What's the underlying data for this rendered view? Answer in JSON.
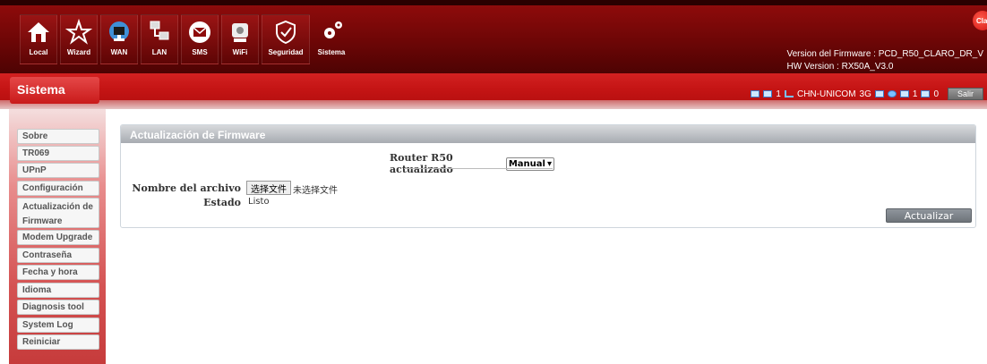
{
  "nav": {
    "items": [
      {
        "label": "Local",
        "icon": "home-icon"
      },
      {
        "label": "Wizard",
        "icon": "wizard-icon"
      },
      {
        "label": "WAN",
        "icon": "wan-icon"
      },
      {
        "label": "LAN",
        "icon": "lan-icon"
      },
      {
        "label": "SMS",
        "icon": "sms-icon"
      },
      {
        "label": "WiFi",
        "icon": "wifi-icon"
      },
      {
        "label": "Seguridad",
        "icon": "shield-icon"
      },
      {
        "label": "Sistema",
        "icon": "gear-icon"
      }
    ]
  },
  "header": {
    "brand": "Claro",
    "firmware_version": "Version del Firmware : PCD_R50_CLARO_DR_V",
    "hw_version": "HW Version : RX50A_V3.0"
  },
  "section": {
    "title": "Sistema"
  },
  "status": {
    "sim_count": "1",
    "operator": "CHN-UNICOM",
    "network": "3G",
    "lan_count": "1",
    "wlan_count": "0",
    "logout_label": "Salir"
  },
  "sidebar": {
    "items": [
      {
        "label": "Sobre"
      },
      {
        "label": "TR069"
      },
      {
        "label": "UPnP"
      },
      {
        "label": "Configuración"
      },
      {
        "label": "Actualización de Firmware"
      },
      {
        "label": "Modem Upgrade"
      },
      {
        "label": "Contraseña"
      },
      {
        "label": "Fecha y hora"
      },
      {
        "label": "Idioma"
      },
      {
        "label": "Diagnosis tool"
      },
      {
        "label": "System Log"
      },
      {
        "label": "Reiniciar"
      }
    ]
  },
  "panel": {
    "title": "Actualización de Firmware",
    "router_label": "Router R50 actualizado",
    "mode_selected": "Manual",
    "file_label": "Nombre del archivo",
    "file_button": "选择文件",
    "file_status": "未选择文件",
    "estado_label": "Estado",
    "estado_value": "Listo",
    "update_button": "Actualizar"
  },
  "colors": {
    "header_dark": "#6c0606",
    "accent_red": "#c41414",
    "panel_header": "#a7abb1"
  }
}
